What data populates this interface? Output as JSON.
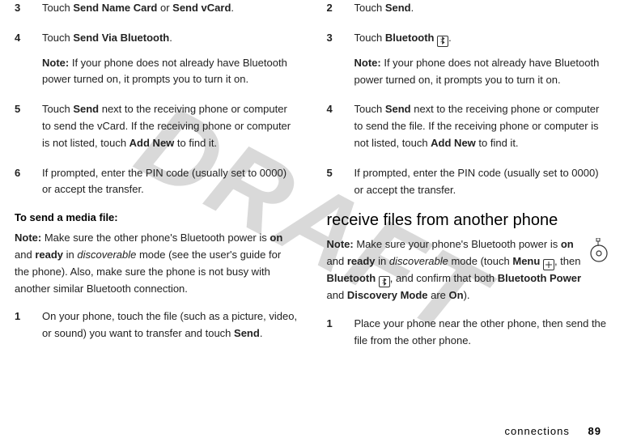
{
  "watermark": "DRAFT",
  "left": {
    "steps_a": [
      {
        "num": "3",
        "prefix": "Touch ",
        "b1": "Send Name Card",
        "mid": " or ",
        "b2": "Send vCard",
        "suffix": "."
      },
      {
        "num": "4",
        "prefix": "Touch ",
        "b1": "Send Via Bluetooth",
        "suffix": "."
      }
    ],
    "note1_label": "Note:",
    "note1_text": " If your phone does not already have Bluetooth power turned on, it prompts you to turn it on.",
    "step5": {
      "num": "5",
      "t1": "Touch ",
      "b1": "Send",
      "t2": " next to the receiving phone or computer to send the vCard. If the receiving phone or computer is not listed, touch ",
      "b2": "Add New",
      "t3": " to find it."
    },
    "step6": {
      "num": "6",
      "text": "If prompted, enter the PIN code (usually set to 0000) or accept the transfer."
    },
    "heading": "To send a media file",
    "note2_label": "Note:",
    "note2": {
      "t1": " Make sure the other phone's Bluetooth power is ",
      "b1": "on",
      "t2": " and ",
      "b2": "ready",
      "t3": " in ",
      "i1": "discoverable",
      "t4": " mode (see the user's guide for the phone). Also, make sure the phone is not busy with another similar Bluetooth connection."
    },
    "step1b": {
      "num": "1",
      "t1": "On your phone, touch the file (such as a picture, video, or sound) you want to transfer and touch ",
      "b1": "Send",
      "t2": "."
    }
  },
  "right": {
    "step2": {
      "num": "2",
      "prefix": "Touch ",
      "b1": "Send",
      "suffix": "."
    },
    "step3": {
      "num": "3",
      "prefix": "Touch ",
      "b1": "Bluetooth",
      "suffix": "."
    },
    "note1_label": "Note:",
    "note1_text": " If your phone does not already have Bluetooth power turned on, it prompts you to turn it on.",
    "step4": {
      "num": "4",
      "t1": "Touch ",
      "b1": "Send",
      "t2": " next to the receiving phone or computer to send the file. If the receiving phone or computer is not listed, touch ",
      "b2": "Add New",
      "t3": " to find it."
    },
    "step5": {
      "num": "5",
      "text": "If prompted, enter the PIN code (usually set to 0000) or accept the transfer."
    },
    "section": "receive files from another phone",
    "note2_label": "Note:",
    "note2": {
      "t1": " Make sure your phone's Bluetooth power is ",
      "b1": "on",
      "t2": " and ",
      "b2": "ready",
      "t3": " in ",
      "i1": "discoverable",
      "t4": " mode (touch ",
      "c1": "Menu",
      "t5": ", then ",
      "c2": "Bluetooth",
      "t6": ", and confirm that both ",
      "c3": "Bluetooth Power",
      "t7": " and ",
      "c4": "Discovery Mode",
      "t8": " are ",
      "c5": "On",
      "t9": ")."
    },
    "step1b": {
      "num": "1",
      "text": "Place your phone near the other phone, then send the file from the other phone."
    }
  },
  "footer": {
    "label": "connections",
    "page": "89"
  },
  "icons": {
    "menu_grid": "menu-grid-icon",
    "bluetooth": "bluetooth-icon",
    "media": "media-disc-icon"
  }
}
